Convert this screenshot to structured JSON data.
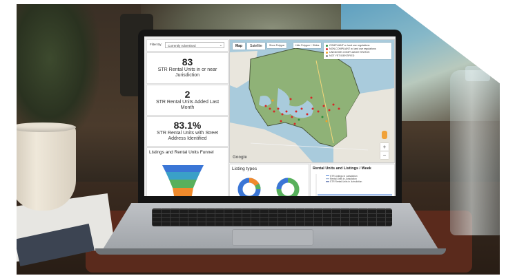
{
  "dashboard": {
    "filter": {
      "label": "Filter By:",
      "value": "Currently Advertised"
    },
    "kpis": [
      {
        "value": "83",
        "label": "STR Rental Units in or near Jurisdiction"
      },
      {
        "value": "2",
        "label": "STR Rental Units Added Last Month"
      },
      {
        "value": "83.1%",
        "label": "STR Rental Units with Street Address Identified"
      }
    ],
    "funnel": {
      "title": "Listings and Rental Units Funnel",
      "colors": [
        "#3b76d6",
        "#3aa0c8",
        "#58b05c",
        "#f08a2c"
      ]
    },
    "map": {
      "tabs": [
        "Map",
        "Satellite"
      ],
      "tools": [
        "Show Polygon",
        "Hide Polygon + Slides"
      ],
      "legend": [
        {
          "label": "COMPLIANT w. land use regulations",
          "color": "#2f8f3a"
        },
        {
          "label": "NON-COMPLIANT w. land use regulations",
          "color": "#d62828"
        },
        {
          "label": "UNKNOWN COMPLIANCE STATUS",
          "color": "#f0a12a"
        },
        {
          "label": "NOT YET IDENTIFIED",
          "color": "#888888"
        }
      ],
      "zoom_in": "+",
      "zoom_out": "−",
      "attribution": "Google"
    },
    "listing_types": {
      "title": "Listing types"
    },
    "rental_week": {
      "title": "Rental Units and Listings / Week",
      "legend": [
        "STR Listings in Jurisdiction",
        "Rental Units in Jurisdiction",
        "STR Rental Units in Jurisdiction"
      ]
    }
  }
}
